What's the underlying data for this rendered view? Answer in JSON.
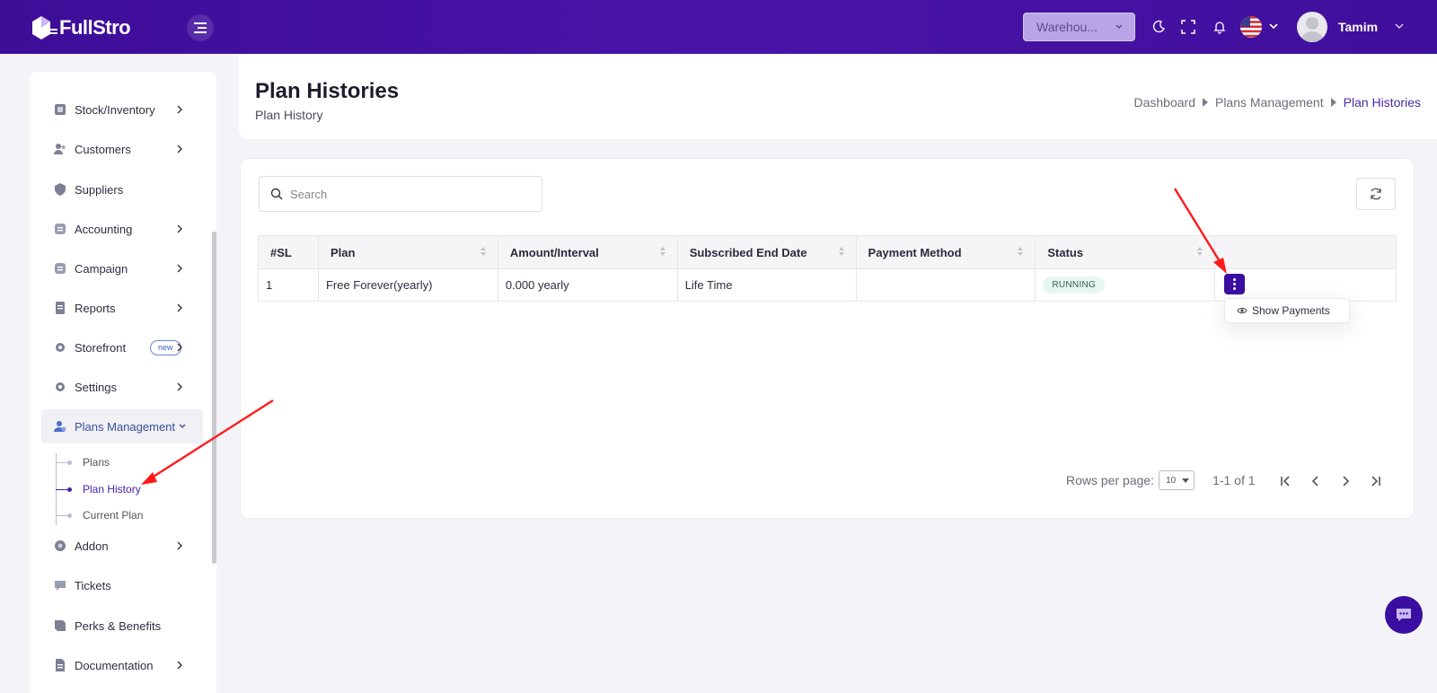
{
  "brand": {
    "name": "FullStro",
    "accent": "#3d0d98"
  },
  "header": {
    "warehouse_value": "Warehou...",
    "username": "Tamim",
    "icons": [
      "menu-icon",
      "moon-icon",
      "fullscreen-icon",
      "bell-icon",
      "us-flag-icon",
      "chevron-down-icon"
    ]
  },
  "sidebar": {
    "items": [
      {
        "label": "Stock/Inventory",
        "icon": "box-icon"
      },
      {
        "label": "Customers",
        "icon": "users-icon"
      },
      {
        "label": "Suppliers",
        "icon": "shield-icon"
      },
      {
        "label": "Accounting",
        "icon": "ledger-icon"
      },
      {
        "label": "Campaign",
        "icon": "campaign-icon"
      },
      {
        "label": "Reports",
        "icon": "report-icon"
      },
      {
        "label": "Storefront",
        "icon": "store-icon",
        "badge": "new"
      },
      {
        "label": "Settings",
        "icon": "gear-icon"
      },
      {
        "label": "Plans Management",
        "icon": "user-plan-icon"
      },
      {
        "label": "Addon",
        "icon": "addon-icon"
      },
      {
        "label": "Tickets",
        "icon": "ticket-icon"
      },
      {
        "label": "Perks & Benefits",
        "icon": "perks-icon"
      },
      {
        "label": "Documentation",
        "icon": "doc-icon"
      }
    ],
    "sub_items": [
      {
        "label": "Plans"
      },
      {
        "label": "Plan History"
      },
      {
        "label": "Current Plan"
      }
    ]
  },
  "page": {
    "title": "Plan Histories",
    "subtitle": "Plan History",
    "breadcrumb": [
      "Dashboard",
      "Plans Management",
      "Plan Histories"
    ]
  },
  "table": {
    "search_placeholder": "Search",
    "columns": [
      "#SL",
      "Plan",
      "Amount/Interval",
      "Subscribed End Date",
      "Payment Method",
      "Status"
    ],
    "rows": [
      {
        "sl": "1",
        "plan": "Free Forever(yearly)",
        "amount": "0.000 yearly",
        "end_date": "Life Time",
        "payment_method": "",
        "status": "RUNNING"
      }
    ],
    "action_menu": {
      "show_payments": "Show Payments"
    }
  },
  "pagination": {
    "rows_per_page_label": "Rows per page:",
    "rows_per_page_value": "10",
    "range": "1-1 of 1"
  }
}
